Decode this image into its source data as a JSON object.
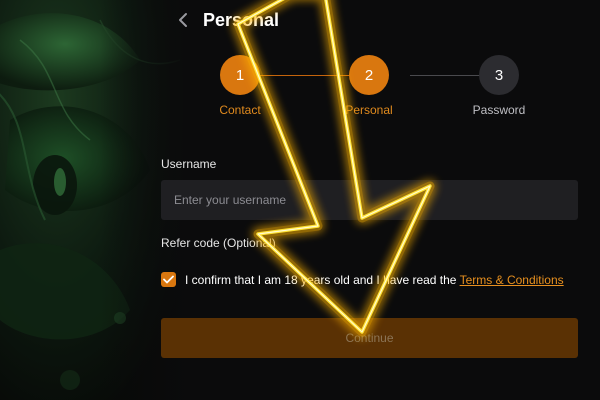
{
  "header": {
    "title": "Personal",
    "back_icon": "chevron-left-icon"
  },
  "stepper": {
    "steps": [
      {
        "number": "1",
        "label": "Contact",
        "state": "completed"
      },
      {
        "number": "2",
        "label": "Personal",
        "state": "active"
      },
      {
        "number": "3",
        "label": "Password",
        "state": "pending"
      }
    ]
  },
  "form": {
    "username_label": "Username",
    "username_placeholder": "Enter your username",
    "username_value": "",
    "refer_label": "Refer code (Optional)",
    "confirm_checked": true,
    "confirm_text": "I confirm that I am 18 years old and I have read the ",
    "terms_link": "Terms & Conditions",
    "continue_label": "Continue"
  },
  "overlay": {
    "arrow_icon": "glowing-arrow-icon",
    "arrow_color": "#ffd400"
  },
  "colors": {
    "accent": "#d9770f",
    "link": "#e8901f",
    "background": "#0b0b0c",
    "input_bg": "#1f1f22",
    "button_disabled_bg": "#5a3104"
  }
}
